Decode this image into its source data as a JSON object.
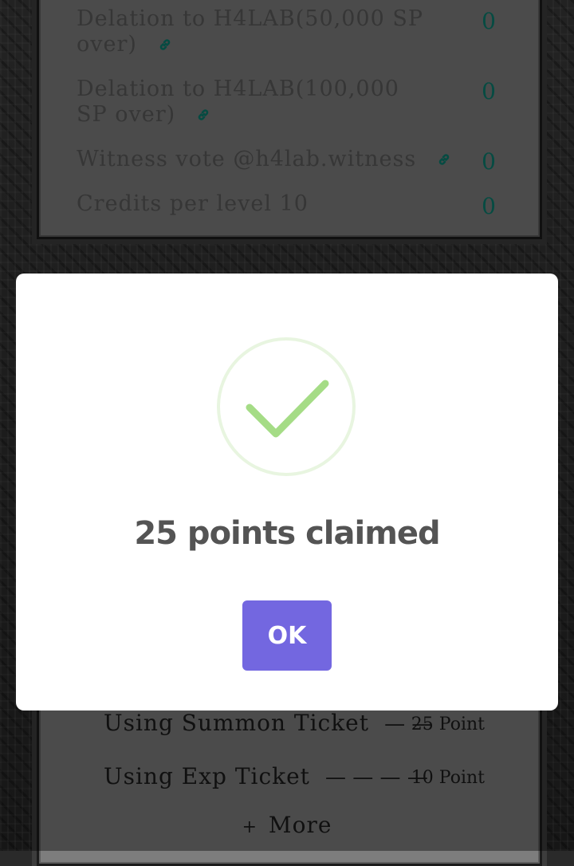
{
  "tasks": [
    {
      "label": "Delation to H4LAB(50,000 SP over)",
      "value": "0",
      "has_link": true
    },
    {
      "label": "Delation to H4LAB(100,000 SP over)",
      "value": "0",
      "has_link": true
    },
    {
      "label": "Witness vote @h4lab.witness",
      "value": "0",
      "has_link": true
    },
    {
      "label": "Credits per level 10",
      "value": "0",
      "has_link": false
    }
  ],
  "rewards": [
    {
      "label": "Using Summon Ticket",
      "dashes": "— —",
      "value": "25 Point"
    },
    {
      "label": "Using Exp Ticket",
      "dashes": "— — — —",
      "value": "10 Point"
    }
  ],
  "more": {
    "plus": "+",
    "label": "More"
  },
  "modal": {
    "icon": "success-check-icon",
    "title": "25 points claimed",
    "ok_label": "OK"
  },
  "colors": {
    "accent": "#7367e0",
    "success": "#a5dc86",
    "value": "#0b7d6e"
  }
}
